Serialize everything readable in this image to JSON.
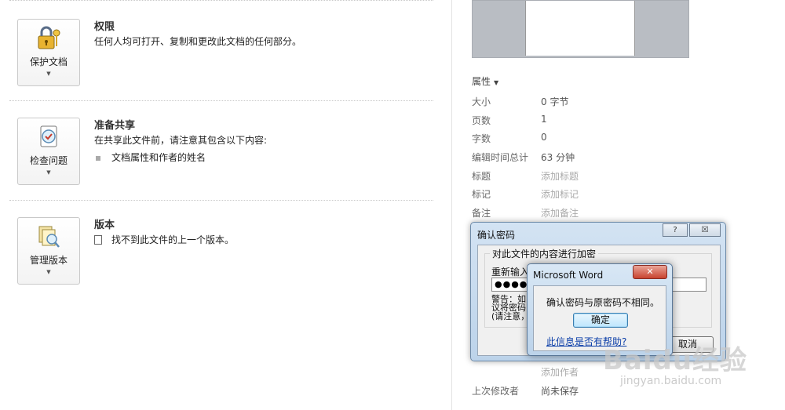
{
  "sections": [
    {
      "button": {
        "label": "保护文档"
      },
      "title": "权限",
      "description": "任何人均可打开、复制和更改此文档的任何部分。"
    },
    {
      "button": {
        "label": "检查问题"
      },
      "title": "准备共享",
      "description": "在共享此文件前，请注意其包含以下内容:",
      "bullet": "文档属性和作者的姓名"
    },
    {
      "button": {
        "label": "管理版本"
      },
      "title": "版本",
      "description": "找不到此文件的上一个版本。"
    }
  ],
  "properties": {
    "title": "属性",
    "items": [
      {
        "key": "大小",
        "value": "0 字节"
      },
      {
        "key": "页数",
        "value": "1"
      },
      {
        "key": "字数",
        "value": "0"
      },
      {
        "key": "编辑时间总计",
        "value": "63 分钟"
      },
      {
        "key": "标题",
        "value": "添加标题"
      },
      {
        "key": "标记",
        "value": "添加标记"
      },
      {
        "key": "备注",
        "value": "添加备注"
      }
    ],
    "author_add": "添加作者",
    "last_modified_by": {
      "key": "上次修改者",
      "value": "尚未保存"
    }
  },
  "confirm_dialog": {
    "title": "确认密码",
    "help_btn": "?",
    "close_btn": "☒",
    "group_legend": "对此文件的内容进行加密",
    "reenter_label": "重新输入",
    "password_mask": "●●●●",
    "warning_text": "警告：如 … 夏。建\n议将密码 … 盘。\n(请注意，",
    "cancel_label": "取消"
  },
  "message_box": {
    "title": "Microsoft Word",
    "close_btn": "✕",
    "message": "确认密码与原密码不相同。",
    "ok_label": "确定",
    "help_link": "此信息是否有帮助?"
  },
  "watermark": {
    "text": "Baidu经验",
    "url": "jingyan.baidu.com"
  },
  "colors": {
    "link": "#0b3ea8",
    "accent": "#3c7fb1"
  }
}
